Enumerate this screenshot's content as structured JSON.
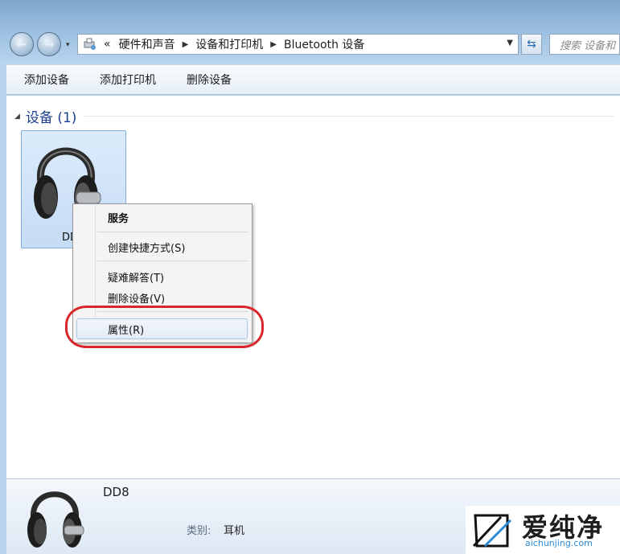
{
  "address_bar": {
    "overflow_marker": "«",
    "crumbs": [
      "硬件和声音",
      "设备和打印机",
      "Bluetooth 设备"
    ],
    "search_placeholder": "搜索 设备和"
  },
  "toolbar": {
    "add_device": "添加设备",
    "add_printer": "添加打印机",
    "remove_device": "删除设备"
  },
  "group": {
    "title": "设备 (1)"
  },
  "device": {
    "tile_label": "DD",
    "icon": "headphones-icon"
  },
  "context_menu": {
    "items": [
      "服务",
      "创建快捷方式(S)",
      "疑难解答(T)",
      "删除设备(V)",
      "属性(R)"
    ],
    "highlighted": "属性(R)"
  },
  "details": {
    "name": "DD8",
    "category_label": "类别:",
    "category_value": "耳机"
  },
  "watermark": {
    "brand": "爱纯净",
    "site": "aichunjing.com"
  },
  "colors": {
    "highlight_ring": "#d9262b",
    "group_title": "#1e3f8f",
    "selection": "#c5dcf5"
  }
}
